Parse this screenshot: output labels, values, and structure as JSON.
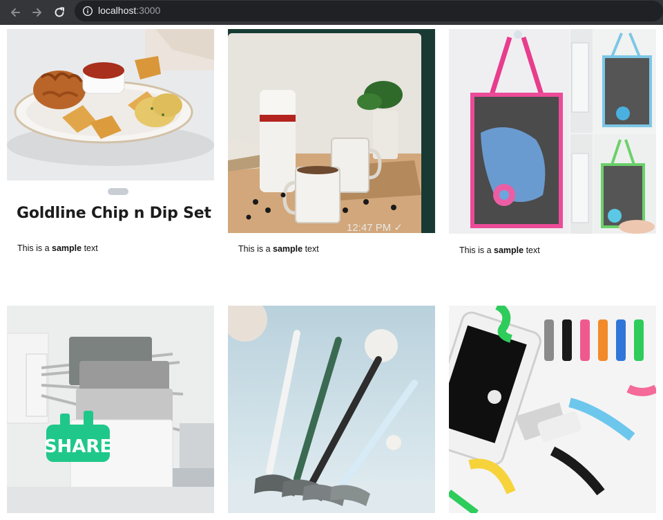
{
  "browser": {
    "url_host": "localhost",
    "url_port": ":3000",
    "icons": [
      "back-arrow-icon",
      "forward-arrow-icon",
      "reload-icon",
      "info-icon"
    ]
  },
  "cards": [
    {
      "image": "chip-and-dip-plate",
      "title": "Goldline Chip n Dip Set",
      "caption_prefix": "This is a ",
      "caption_bold": "sample",
      "caption_suffix": " text"
    },
    {
      "image": "mugs-and-flask-photo",
      "timestamp": "12:47 PM ✓",
      "caption_prefix": "This is a ",
      "caption_bold": "sample",
      "caption_suffix": " text"
    },
    {
      "image": "hanging-mesh-bag-organizer",
      "caption_prefix": "This is a ",
      "caption_bold": "sample",
      "caption_suffix": " text"
    },
    {
      "image": "towel-rack",
      "badge": "SHARE"
    },
    {
      "image": "toilet-brushes"
    },
    {
      "image": "cable-protectors"
    }
  ],
  "colors": {
    "chrome_bg": "#35363a",
    "url_bg": "#202124",
    "share_green": "#1fc88a"
  }
}
